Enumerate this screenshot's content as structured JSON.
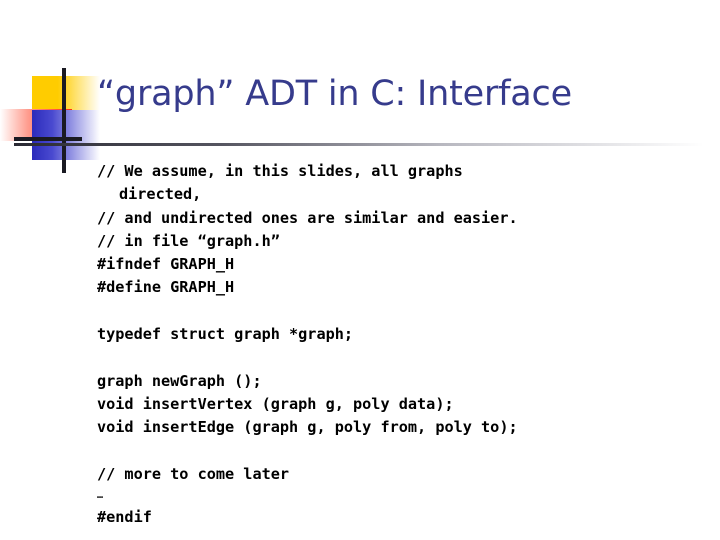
{
  "slide": {
    "title": "“graph” ADT in C: Interface",
    "title_color": "#363b8c",
    "background_color": "#ffffff",
    "body_color": "#000000",
    "ornament": {
      "yellow_color": "#ffcc00",
      "red_color": "#ff2a18",
      "blue_color": "#2b2bbb",
      "line_color": "#1a1a22"
    },
    "body_lines": [
      {
        "text": "// We assume, in this slides, all graphs",
        "style": "normal"
      },
      {
        "text": "directed,",
        "style": "cont"
      },
      {
        "text": "// and undirected ones are similar and easier.",
        "style": "normal"
      },
      {
        "text": "// in file “graph.h”",
        "style": "normal"
      },
      {
        "text": "#ifndef GRAPH_H",
        "style": "normal"
      },
      {
        "text": "#define GRAPH_H",
        "style": "normal"
      },
      {
        "text": "",
        "style": "blank"
      },
      {
        "text": "typedef struct graph *graph;",
        "style": "normal"
      },
      {
        "text": "",
        "style": "blank"
      },
      {
        "text": "graph newGraph ();",
        "style": "normal"
      },
      {
        "text": "void insertVertex (graph g, poly data);",
        "style": "normal"
      },
      {
        "text": "void insertEdge (graph g, poly from, poly to);",
        "style": "normal"
      },
      {
        "text": "",
        "style": "blank"
      },
      {
        "text": "// more to come later",
        "style": "normal"
      },
      {
        "text": "…",
        "style": "small"
      },
      {
        "text": "#endif",
        "style": "normal"
      }
    ]
  }
}
